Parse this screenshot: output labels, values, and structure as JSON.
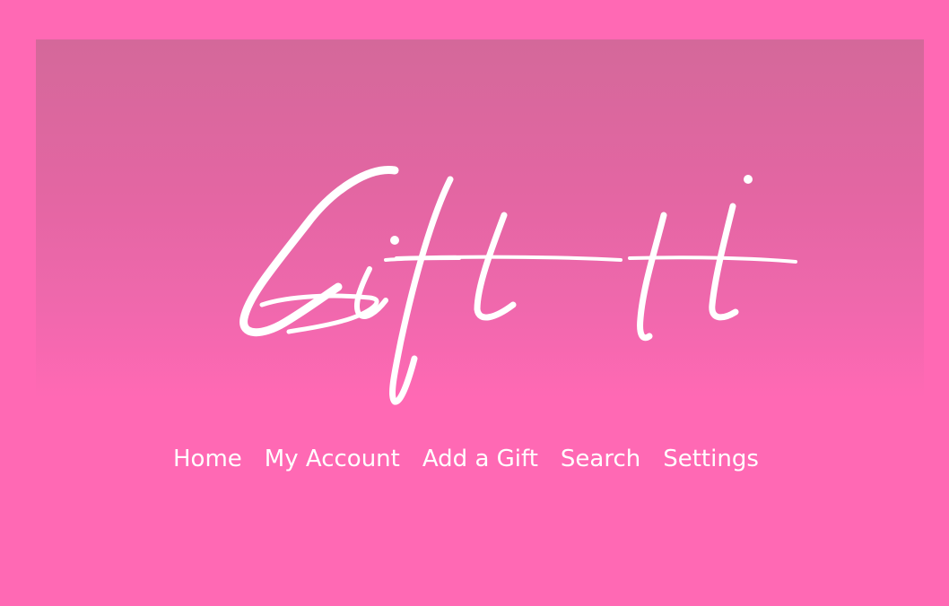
{
  "brand": {
    "name": "Gift It",
    "background_color": "#ff69b4",
    "banner_top_color": "#d4689a",
    "text_color": "#ffffff"
  },
  "nav": {
    "items": [
      {
        "label": "Home"
      },
      {
        "label": "My Account"
      },
      {
        "label": "Add a Gift"
      },
      {
        "label": "Search"
      },
      {
        "label": "Settings"
      }
    ]
  }
}
